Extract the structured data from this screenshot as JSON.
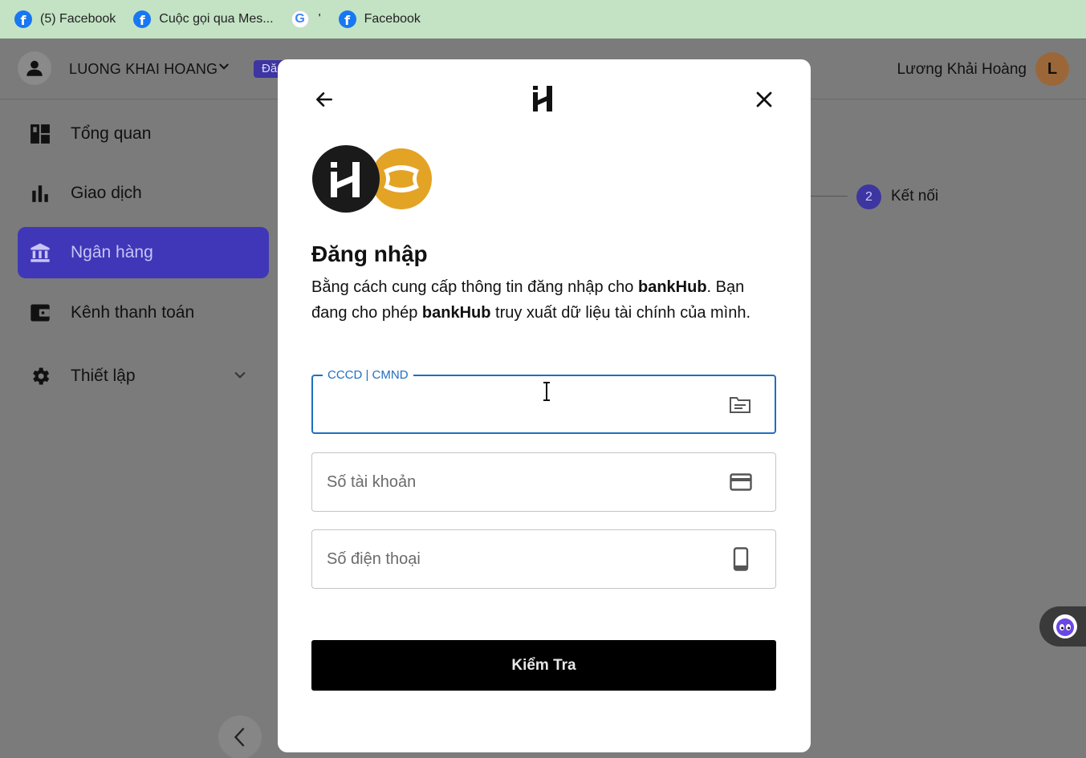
{
  "bookmarks": [
    {
      "label": "(5) Facebook",
      "icon": "facebook-icon"
    },
    {
      "label": "Cuộc gọi qua Mes...",
      "icon": "facebook-icon"
    },
    {
      "label": "'",
      "icon": "google-icon"
    },
    {
      "label": "Facebook",
      "icon": "facebook-icon"
    }
  ],
  "header": {
    "account_name": "LUONG KHAI HOANG",
    "badge": "Đă",
    "user_name": "Lương Khải Hoàng",
    "avatar_initial": "L"
  },
  "sidebar": {
    "items": [
      {
        "label": "Tổng quan",
        "icon": "dashboard-icon"
      },
      {
        "label": "Giao dịch",
        "icon": "bar-chart-icon"
      },
      {
        "label": "Ngân hàng",
        "icon": "bank-icon",
        "active": true
      },
      {
        "label": "Kênh thanh toán",
        "icon": "wallet-icon"
      },
      {
        "label": "Thiết lập",
        "icon": "gear-icon"
      }
    ]
  },
  "stepper": {
    "step_number": "2",
    "step_label": "Kết nối"
  },
  "modal": {
    "title": "Đăng nhập",
    "desc_part1": "Bằng cách cung cấp thông tin đăng nhập cho ",
    "desc_brand1": "bankHub",
    "desc_part2": ". Bạn đang cho phép ",
    "desc_brand2": "bankHub",
    "desc_part3": " truy xuất dữ liệu tài chính của mình.",
    "fields": {
      "id_label": "CCCD | CMND",
      "id_value": "",
      "account_placeholder": "Số tài khoản",
      "phone_placeholder": "Số điện thoại"
    },
    "submit_label": "Kiểm Tra"
  },
  "colors": {
    "primary": "#3f37b8",
    "focus_blue": "#1f6fbe",
    "bookmarks_bg": "#c3e3c4",
    "avatar_bg": "#9c6738",
    "bank_logo_gold": "#e3a324"
  }
}
